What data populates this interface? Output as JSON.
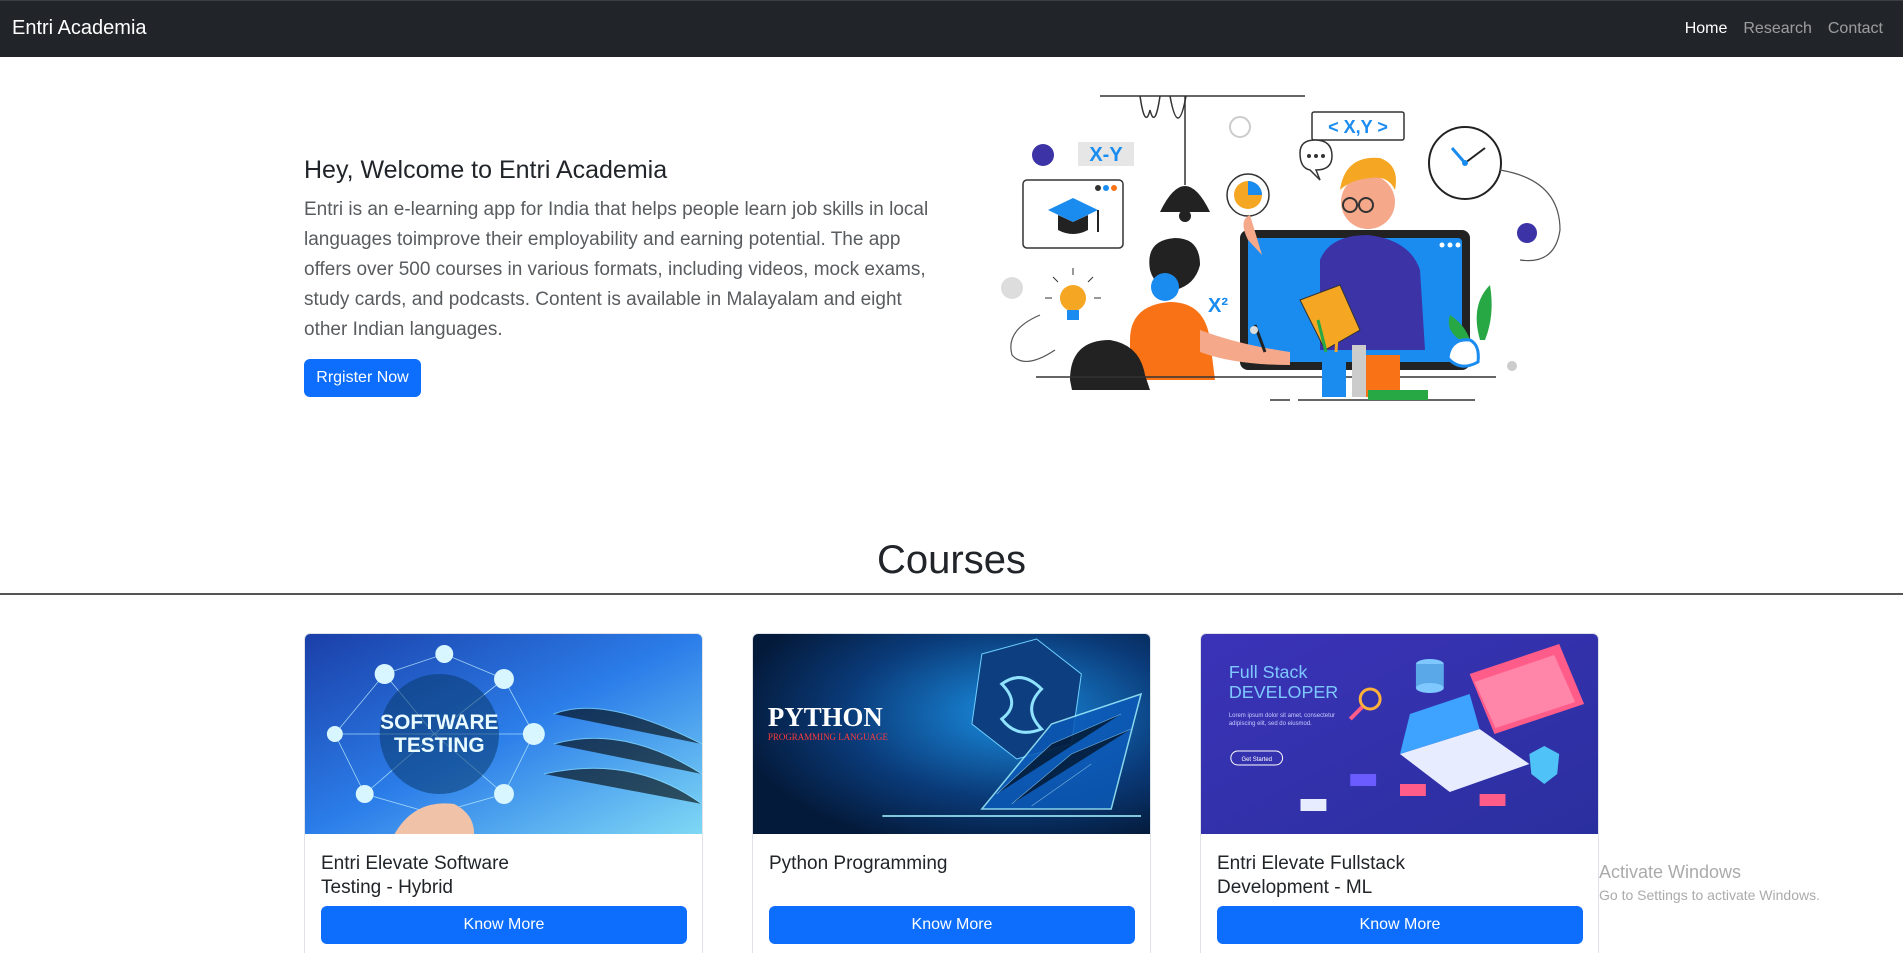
{
  "navbar": {
    "brand": "Entri Academia",
    "links": [
      "Home",
      "Research",
      "Contact"
    ]
  },
  "hero": {
    "title": "Hey, Welcome to Entri Academia",
    "lead": "Entri is an e-learning app for India that helps people learn job skills in local languages toimprove their employability and earning potential. The app offers over 500 courses in various formats, including videos, mock exams, study cards, and podcasts. Content is available in Malayalam and eight other Indian languages.",
    "register_label": "Rrgister Now",
    "illustration_labels": {
      "xy_minus": "X-Y",
      "xy_pair": "< X,Y >",
      "x_squared": "X²"
    }
  },
  "courses": {
    "title": "Courses",
    "items": [
      {
        "title": "Entri Elevate Software Testing - Hybrid",
        "button": "Know More",
        "image_text": [
          "SOFTWARE",
          "TESTING"
        ]
      },
      {
        "title": "Python Programming",
        "button": "Know More",
        "image_text": [
          "PYTHON",
          "PROGRAMMING LANGUAGE"
        ]
      },
      {
        "title": "Entri Elevate Fullstack Development - ML",
        "button": "Know More",
        "image_text": [
          "Full Stack",
          "DEVELOPER",
          "Lorem ipsum dolor sit amet, consectetur adipiscing elit, sed do eiusmod.",
          "Get Started"
        ]
      }
    ]
  },
  "watermark": {
    "title": "Activate Windows",
    "subtitle": "Go to Settings to activate Windows."
  },
  "colors": {
    "navbar": "#212529",
    "primary": "#0d6efd",
    "accent_orange": "#f97316",
    "accent_blue": "#1a8cf0",
    "indigo": "#3b33a6"
  }
}
